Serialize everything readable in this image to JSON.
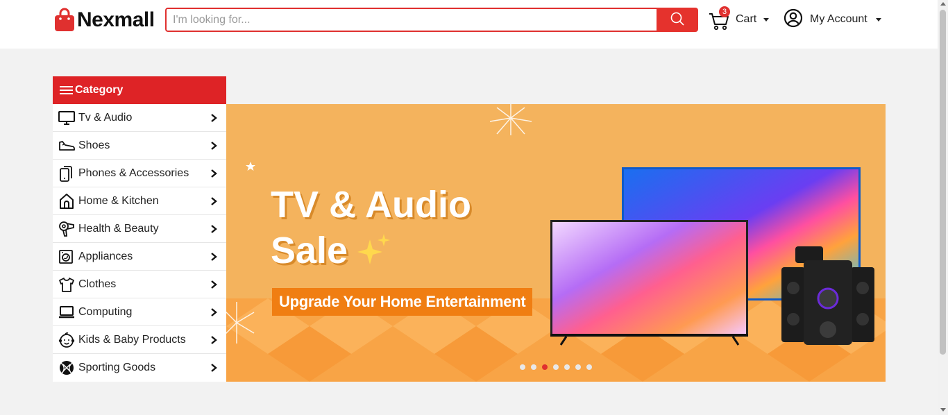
{
  "header": {
    "logo_text": "Nexmall",
    "search_placeholder": "I'm looking for...",
    "cart_label": "Cart",
    "cart_count": "3",
    "account_label": "My Account"
  },
  "category": {
    "title": "Category",
    "items": [
      {
        "label": "Tv & Audio",
        "icon": "tv-icon"
      },
      {
        "label": "Shoes",
        "icon": "shoe-icon"
      },
      {
        "label": "Phones & Accessories",
        "icon": "phone-icon"
      },
      {
        "label": "Home & Kitchen",
        "icon": "home-icon"
      },
      {
        "label": "Health & Beauty",
        "icon": "hair-dryer-icon"
      },
      {
        "label": "Appliances",
        "icon": "washing-machine-icon"
      },
      {
        "label": "Clothes",
        "icon": "shirt-icon"
      },
      {
        "label": "Computing",
        "icon": "laptop-icon"
      },
      {
        "label": "Kids & Baby Products",
        "icon": "baby-face-icon"
      },
      {
        "label": "Sporting Goods",
        "icon": "basketball-icon"
      }
    ]
  },
  "banner": {
    "title_line1": "TV & Audio",
    "title_line2": "Sale",
    "subtitle": "Upgrade Your Home Entertainment",
    "slide_count": 7,
    "active_slide": 3
  },
  "colors": {
    "brand_red": "#de2326",
    "banner_orange": "#f4b35d",
    "subtitle_orange": "#f07e12"
  }
}
